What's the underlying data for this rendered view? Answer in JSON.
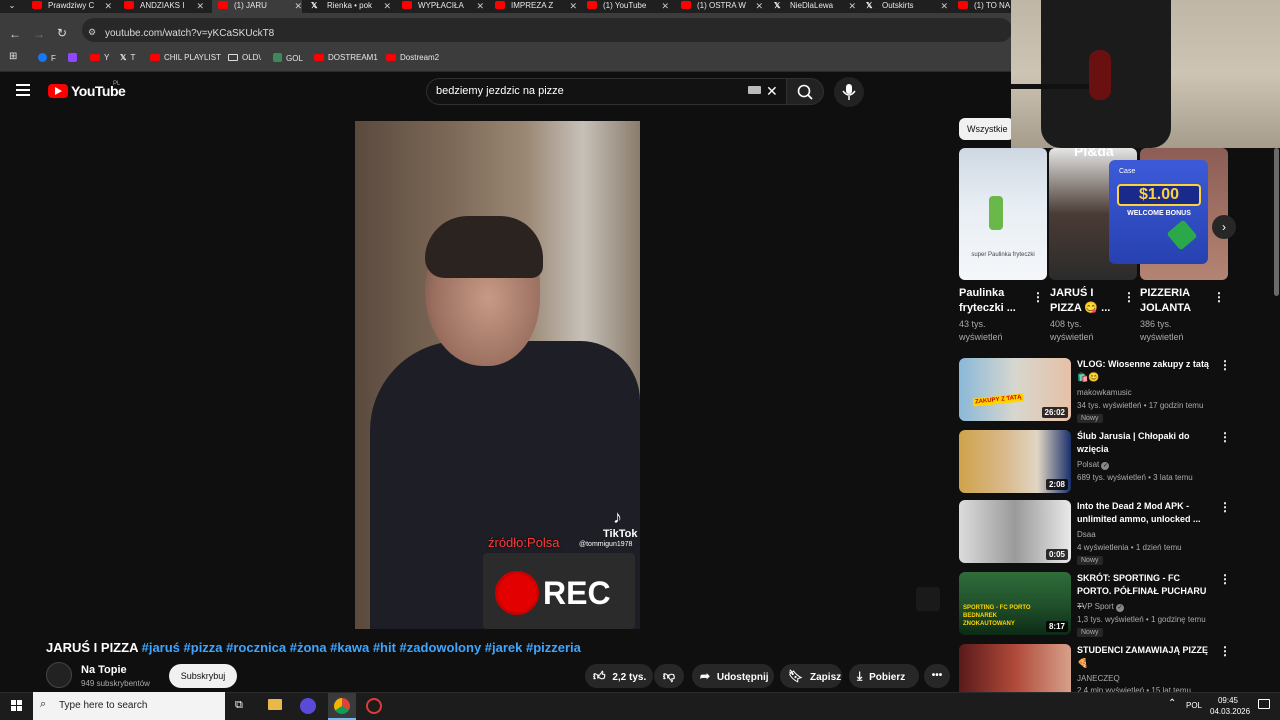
{
  "browser": {
    "tabs": [
      {
        "label": "Prawdziwy C",
        "icon": "youtube"
      },
      {
        "label": "ANDZIAKS I",
        "icon": "youtube"
      },
      {
        "label": "(1) JARU",
        "icon": "youtube",
        "active": true
      },
      {
        "label": "Rienka • pok",
        "icon": "x"
      },
      {
        "label": "WYPŁACIŁA",
        "icon": "youtube"
      },
      {
        "label": "IMPREZA Z",
        "icon": "youtube"
      },
      {
        "label": "(1) YouTube",
        "icon": "youtube"
      },
      {
        "label": "(1) OSTRA W",
        "icon": "youtube"
      },
      {
        "label": "NieDlaLewa",
        "icon": "x"
      },
      {
        "label": "Outskirts",
        "icon": "x"
      },
      {
        "label": "(1) TO NA",
        "icon": "youtube"
      }
    ],
    "url": "youtube.com/watch?v=yKCaSKUckT8",
    "bookmarks": [
      "F",
      "Y",
      "T",
      "CHIL PLAYLIST",
      "OLD\\",
      "GOL",
      "DOSTREAM1",
      "Dostream2"
    ]
  },
  "header": {
    "logo_text": "YouTube",
    "region": "PL",
    "search_query": "bedziemy jezdzic na pizze"
  },
  "video": {
    "source_text": "źródło:Polsa",
    "tiktok_label": "TikTok",
    "tiktok_handle": "@tommigun1978",
    "rec_label": "REC"
  },
  "watch": {
    "title": "JARUŚ I PIZZA",
    "hashtags": "#jaruś #pizza #rocznica #żona #kawa #hit #zadowolony #jarek #pizzeria",
    "channel_name": "Na Topie",
    "channel_subs": "949 subskrybentów",
    "subscribe_label": "Subskrybuj",
    "like_count": "2,2 tys.",
    "share_label": "Udostępnij",
    "save_label": "Zapisz",
    "download_label": "Pobierz"
  },
  "sidebar": {
    "chip": "Wszystkie",
    "shorts_overlay_text": "Pl&da",
    "promo": {
      "amount": "$1.00",
      "label": "WELCOME BONUS",
      "brand": "Case"
    },
    "shorts": [
      {
        "title": "Paulinka fryteczki ...",
        "views": "43 tys. wyświetleń",
        "caption": "super Paulinka fryteczki"
      },
      {
        "title": "JARUŚ I PIZZA 😋 ...",
        "views": "408 tys. wyświetleń"
      },
      {
        "title": "PIZZERIA JOLANTA",
        "views": "386 tys. wyświetleń"
      }
    ],
    "videos": [
      {
        "title": "VLOG: Wiosenne zakupy z tatą 🛍️😊",
        "channel": "makowkamusic",
        "meta": "34 tys. wyświetleń • 17 godzin temu",
        "badge": "Nowy",
        "duration": "26:02",
        "thumb_text": "ZAKUPY Z TATĄ"
      },
      {
        "title": "Ślub Jarusia | Chłopaki do wzięcia",
        "channel": "Polsat",
        "meta": "689 tys. wyświetleń • 3 lata temu",
        "badge": "",
        "duration": "2:08"
      },
      {
        "title": "Into the Dead 2 Mod APK - unlimited ammo, unlocked ...",
        "channel": "Dsaa",
        "meta": "4 wyświetlenia • 1 dzień temu",
        "badge": "Nowy",
        "duration": "0:05"
      },
      {
        "title": "SKRÓT: SPORTING - FC PORTO. PÓŁFINAŁ PUCHARU ...",
        "channel": "TVP Sport",
        "meta": "1,3 tys. wyświetleń • 1 godzinę temu",
        "badge": "Nowy",
        "duration": "8:17",
        "thumb_text": "SPORTING - FC PORTO BEDNAREK ZNOKAUTOWANY"
      },
      {
        "title": "STUDENCI ZAMAWIAJĄ PIZZĘ 🍕",
        "channel": "JANECZEQ",
        "meta": "2,4 mln wyświetleń • 15 lat temu",
        "badge": "",
        "duration": ""
      }
    ]
  },
  "taskbar": {
    "search_placeholder": "Type here to search",
    "lang": "POL",
    "time": "09:45",
    "date": "04.03.2026"
  },
  "colors": {
    "accent": "#ff0000",
    "link": "#3ea6ff",
    "background": "#0f0f0f"
  }
}
